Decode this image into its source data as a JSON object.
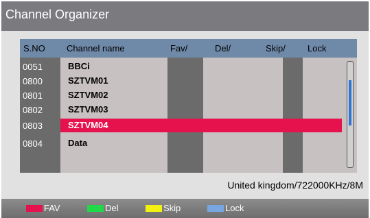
{
  "title": "Channel Organizer",
  "headers": {
    "sno": "S.NO",
    "name": "Channel name",
    "fav": "Fav/",
    "del": "Del/",
    "skip": "Skip/",
    "lock": "Lock"
  },
  "channels": [
    {
      "no": "0051",
      "name": "BBCi"
    },
    {
      "no": "0800",
      "name": "SZTVM01"
    },
    {
      "no": "0801",
      "name": "SZTVM02"
    },
    {
      "no": "0802",
      "name": "SZTVM03"
    },
    {
      "no": "0803",
      "name": "SZTVM04",
      "selected": true
    },
    {
      "no": "0804",
      "name": "Data"
    }
  ],
  "scroll_position": 0.3,
  "info": "United kingdom/722000KHz/8M",
  "legend": [
    {
      "label": "FAV",
      "color": "#e6124e"
    },
    {
      "label": "Del",
      "color": "#20d848"
    },
    {
      "label": "Skip",
      "color": "#f4f010"
    },
    {
      "label": "Lock",
      "color": "#78a6e0"
    }
  ],
  "colors": {
    "title_bar": "#7a7a7f",
    "header": "#6f89a8",
    "selection": "#e6124e",
    "scrollbar_thumb": "#2e73d8"
  }
}
